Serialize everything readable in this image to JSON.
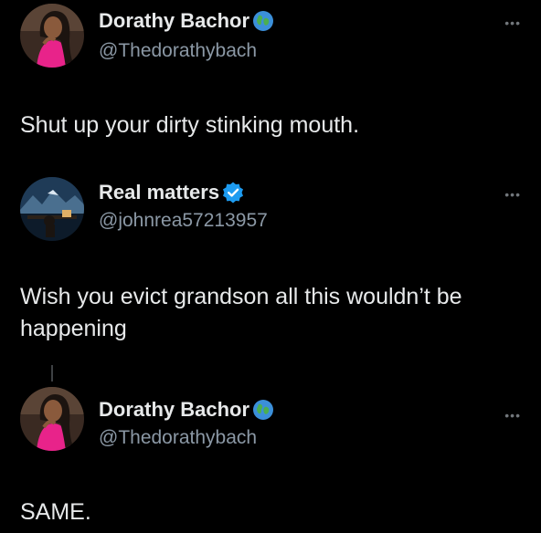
{
  "tweets": [
    {
      "display_name": "Dorathy Bachor",
      "handle": "@Thedorathybach",
      "badge_icon": "globe-emoji",
      "text": "Shut up your dirty stinking mouth.",
      "more_label": "•••"
    },
    {
      "display_name": "Real matters",
      "handle": "@johnrea57213957",
      "badge_icon": "verified-check",
      "text": "Wish you evict grandson all this wouldn’t be happening",
      "more_label": "•••"
    },
    {
      "display_name": "Dorathy Bachor",
      "handle": "@Thedorathybach",
      "badge_icon": "globe-emoji",
      "text": "SAME.",
      "more_label": "•••"
    }
  ],
  "colors": {
    "background": "#000000",
    "primary_text": "#e7e9ea",
    "secondary_text": "#8b98a5",
    "verified_blue": "#1d9bf0",
    "avatar_pink": "#e8238a"
  }
}
